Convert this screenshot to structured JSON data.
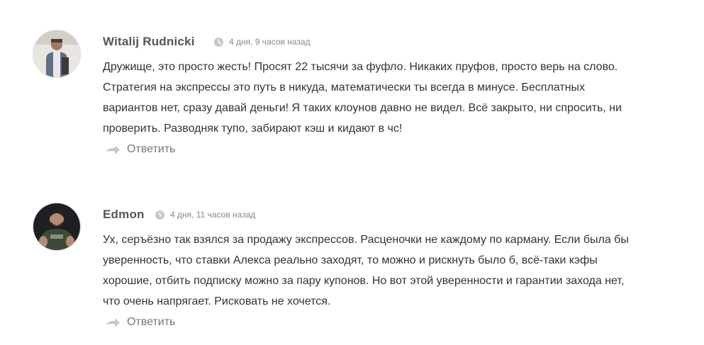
{
  "comments": [
    {
      "author": "Witalij Rudnicki",
      "time": "4 дня, 9 часов назад",
      "lines": [
        "Дружище, это просто жесть! Просят 22 тысячи за фуфло. Никаких пруфов, просто верь на слово.",
        "Стратегия на экспрессы это путь в никуда, математически ты всегда в минусе. Бесплатных",
        "вариантов нет, сразу давай деньги! Я таких клоунов давно не видел. Всё закрыто, ни спросить, ни",
        "проверить. Разводняк тупо, забирают кэш и кидают в чс!"
      ],
      "reply_label": "Ответить"
    },
    {
      "author": "Edmon",
      "time": "4 дня, 11 часов назад",
      "lines": [
        "Ух, серъёзно так взялся за продажу экспрессов. Расценочки не каждому по карману. Если была бы",
        "уверенность, что ставки Алекса реально заходят, то можно и рискнуть было б, всё-таки кэфы",
        "хорошие, отбить подписку можно за пару купонов. Но вот этой уверенности и гарантии захода нет,",
        "что очень напрягает. Рисковать не хочется."
      ],
      "reply_label": "Ответить"
    }
  ],
  "icons": {
    "clock": "clock-icon",
    "reply": "reply-arrow-icon"
  },
  "colors": {
    "author": "#555555",
    "meta": "#888888",
    "body": "#333333",
    "reply": "#777777",
    "icon": "#c8c8c8"
  }
}
